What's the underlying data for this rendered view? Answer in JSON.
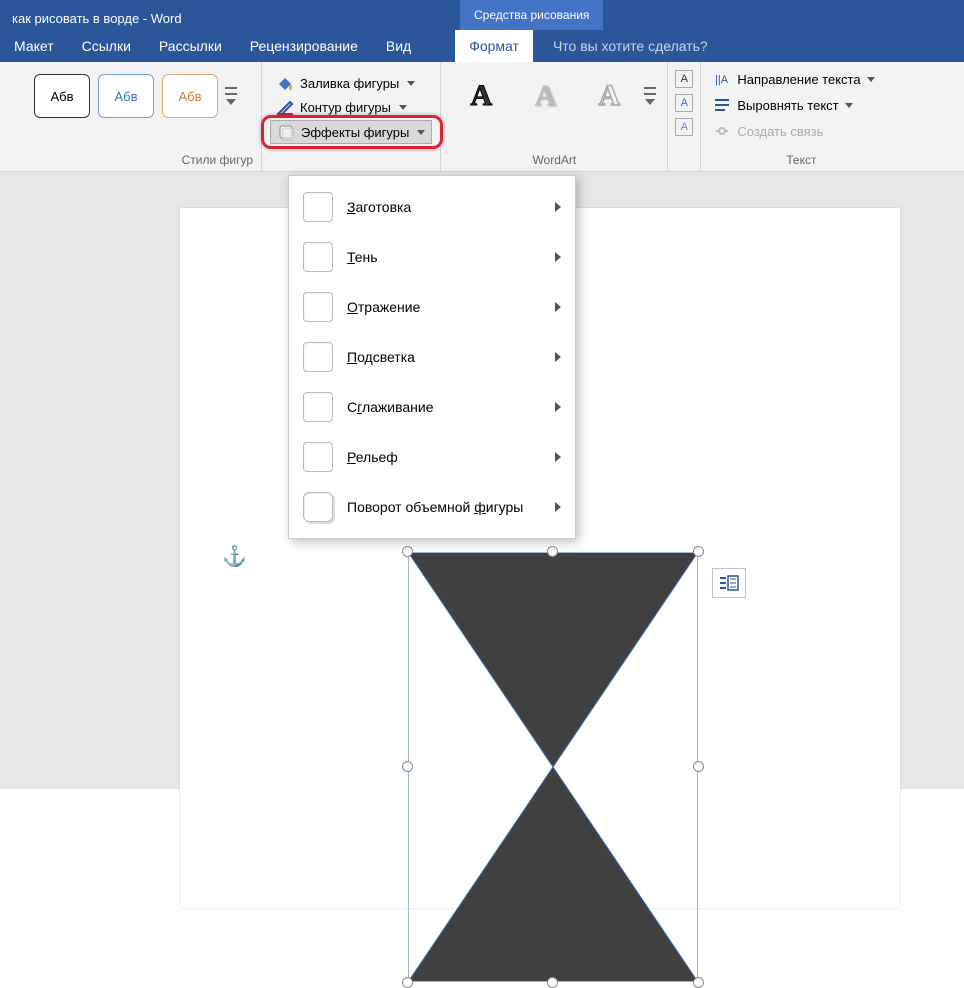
{
  "title": "как рисовать в ворде - Word",
  "tool_tab_title": "Средства рисования",
  "tabs": {
    "layout": "Макет",
    "references": "Ссылки",
    "mailings": "Рассылки",
    "review": "Рецензирование",
    "view": "Вид",
    "format": "Формат",
    "tellme": "Что вы хотите сделать?"
  },
  "ribbon": {
    "shape_styles_label": "Стили фигур",
    "wordart_label": "WordArt",
    "text_label": "Текст",
    "swatch_text": "Абв",
    "fill": "Заливка фигуры",
    "outline": "Контур фигуры",
    "effects": "Эффекты фигуры",
    "text_direction": "Направление текста",
    "align_text": "Выровнять текст",
    "create_link": "Создать связь",
    "wordart_A": "A"
  },
  "menu": {
    "preset": "Заготовка",
    "shadow": "Тень",
    "reflection": "Отражение",
    "glow": "Подсветка",
    "soft_edges": "Сглаживание",
    "bevel": "Рельеф",
    "rotation3d": "Поворот объемной фигуры"
  },
  "colors": {
    "accent": "#2b579a"
  }
}
